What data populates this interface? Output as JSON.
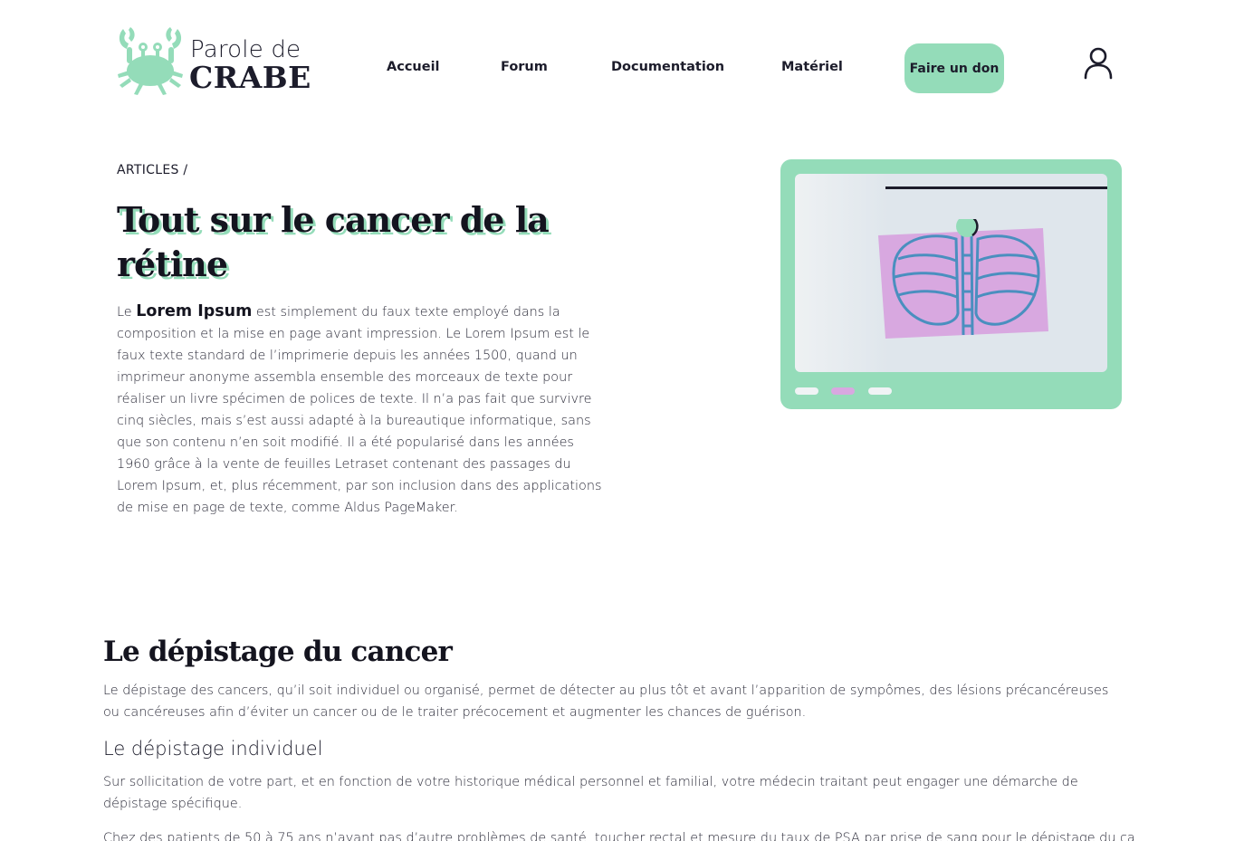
{
  "brand": {
    "line1": "Parole de",
    "line2": "CRABE",
    "accent_color": "#94dcb9"
  },
  "nav": {
    "items": [
      {
        "label": "Accueil"
      },
      {
        "label": "Forum"
      },
      {
        "label": "Documentation"
      },
      {
        "label": "Matériel"
      }
    ],
    "donate_label": "Faire un don",
    "user_icon": "user-icon"
  },
  "hero": {
    "breadcrumb": "ARTICLES /",
    "title": "Tout sur le cancer de la rétine",
    "intro_prefix": "Le ",
    "intro_strong": "Lorem Ipsum",
    "intro_rest": " est simplement du faux texte employé dans la composition et la mise en page avant impression. Le Lorem Ipsum est le faux texte standard de l’imprimerie depuis les années 1500, quand un imprimeur anonyme assembla ensemble des morceaux de texte pour réaliser un livre spécimen de polices de texte. Il n’a pas fait que survivre cinq siècles, mais s’est aussi adapté à la bureautique informatique, sans que son contenu n’en soit modifié. Il a été popularisé dans les années 1960 grâce à la vente de feuilles Letraset contenant des passages du Lorem Ipsum, et, plus récemment, par son inclusion dans des applications de mise en page de texte, comme Aldus PageMaker.",
    "media": {
      "illustration": "xray-lungs-illustration",
      "colors": {
        "card": "#94dcb9",
        "xray_plate": "#d8a8e0",
        "lines": "#4a8fbf"
      },
      "carousel_dots": [
        {
          "color": "#f0f3f5",
          "active": false
        },
        {
          "color": "#d8a8e0",
          "active": true
        },
        {
          "color": "#f0f3f5",
          "active": false
        }
      ]
    }
  },
  "section": {
    "title": "Le dépistage du cancer",
    "paragraph1": "Le dépistage des cancers, qu’il soit individuel ou organisé, permet de détecter au plus tôt et avant l’apparition de sympômes, des lésions précancéreuses ou cancéreuses afin d’éviter un cancer ou de le traiter précocement et augmenter les chances de guérison.",
    "subtitle": "Le dépistage individuel",
    "paragraph2": "Sur sollicitation de votre part, et en fonction de votre historique médical personnel et familial, votre médecin traitant peut engager une démarche de dépistage spécifique.",
    "paragraph3": "Chez des patients de 50 à 75 ans n’ayant pas d’autre problèmes de santé, toucher rectal et mesure du taux de PSA par prise de sang pour le dépistage du cancer"
  }
}
